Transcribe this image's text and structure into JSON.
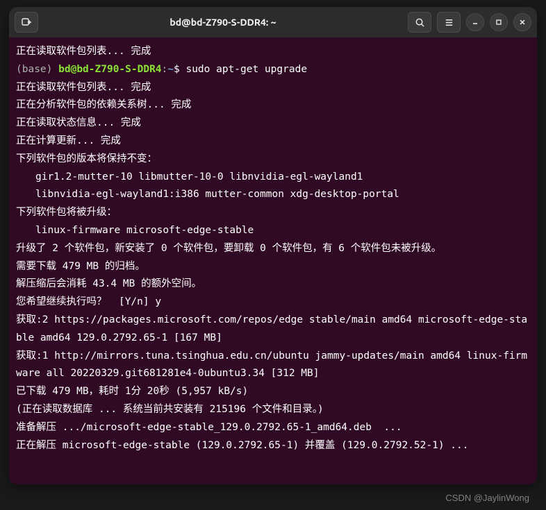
{
  "titlebar": {
    "title": "bd@bd-Z790-S-DDR4: ~"
  },
  "prompt": {
    "base": "(base)",
    "userhost": "bd@bd-Z790-S-DDR4",
    "colon": ":",
    "path": "~",
    "dollar": "$",
    "command": "sudo apt-get upgrade"
  },
  "lines": {
    "read_pkg_list": "正在读取软件包列表... 完成",
    "read_pkg_list2": "正在读取软件包列表... 完成",
    "analyze_deps": "正在分析软件包的依赖关系树... 完成",
    "read_state": "正在读取状态信息... 完成",
    "calc_update": "正在计算更新... 完成",
    "kept_back_header": "下列软件包的版本将保持不变：",
    "kept_back_1": "gir1.2-mutter-10 libmutter-10-0 libnvidia-egl-wayland1",
    "kept_back_2": "libnvidia-egl-wayland1:i386 mutter-common xdg-desktop-portal",
    "upgrade_header": "下列软件包将被升级：",
    "upgrade_1": "linux-firmware microsoft-edge-stable",
    "summary": "升级了 2 个软件包，新安装了 0 个软件包，要卸载 0 个软件包，有 6 个软件包未被升级。",
    "need_download": "需要下载 479 MB 的归档。",
    "after_decompress": "解压缩后会消耗 43.4 MB 的额外空间。",
    "continue_prompt": "您希望继续执行吗？  [Y/n] y",
    "get2": "获取:2 https://packages.microsoft.com/repos/edge stable/main amd64 microsoft-edge-stable amd64 129.0.2792.65-1 [167 MB]",
    "get1": "获取:1 http://mirrors.tuna.tsinghua.edu.cn/ubuntu jammy-updates/main amd64 linux-firmware all 20220329.git681281e4-0ubuntu3.34 [312 MB]",
    "downloaded": "已下载 479 MB，耗时 1分 20秒 (5,957 kB/s)",
    "reading_db": "(正在读取数据库 ... 系统当前共安装有 215196 个文件和目录。)",
    "prepare_unpack": "准备解压 .../microsoft-edge-stable_129.0.2792.65-1_amd64.deb  ...",
    "unpacking": "正在解压 microsoft-edge-stable (129.0.2792.65-1) 并覆盖 (129.0.2792.52-1) ..."
  },
  "watermark": "CSDN @JaylinWong"
}
